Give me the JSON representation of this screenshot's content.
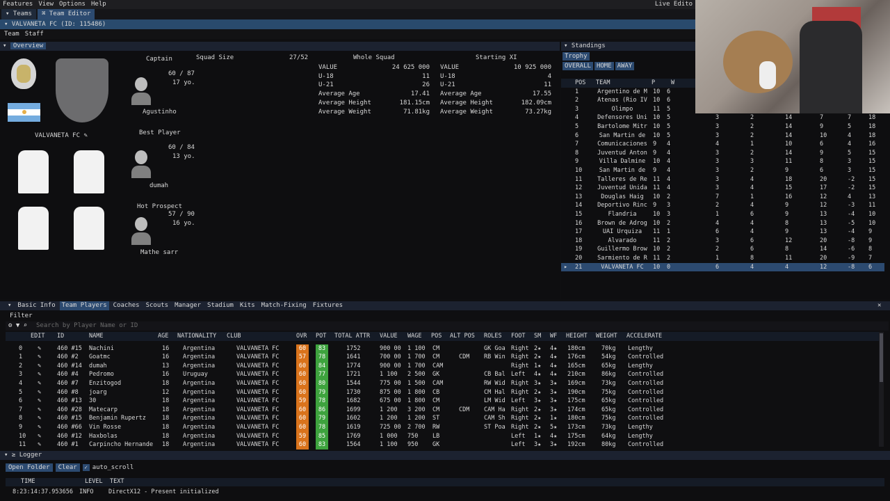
{
  "menubar": {
    "items": [
      "Features",
      "View",
      "Options",
      "Help"
    ],
    "right": "Live Edito"
  },
  "tabs": [
    {
      "label": "▾ Teams"
    },
    {
      "label": "⌘ Team Editor"
    }
  ],
  "title": "VALVANETA FC (ID: 115486)",
  "subtabs": [
    "Team",
    "Staff"
  ],
  "overview": {
    "header": "Overview",
    "club_name": "VALVANETA FC",
    "captain": {
      "label": "Captain",
      "rating": "60 / 87",
      "age": "17 yo.",
      "name": "Agustinho"
    },
    "best": {
      "label": "Best Player",
      "rating": "60 / 84",
      "age": "13 yo.",
      "name": "dumah"
    },
    "prospect": {
      "label": "Hot Prospect",
      "rating": "57 / 90",
      "age": "16 yo.",
      "name": "Mathe sarr"
    },
    "squad_size_label": "Squad Size",
    "squad_size": "27/52",
    "whole_label": "Whole Squad",
    "xi_label": "Starting XI",
    "whole": [
      {
        "k": "VALUE",
        "v": "24 625 000"
      },
      {
        "k": "U-18",
        "v": "11"
      },
      {
        "k": "U-21",
        "v": "26"
      },
      {
        "k": "Average Age",
        "v": "17.41"
      },
      {
        "k": "Average Height",
        "v": "181.15cm"
      },
      {
        "k": "Average Weight",
        "v": "71.81kg"
      }
    ],
    "xi": [
      {
        "k": "VALUE",
        "v": "10 925 000"
      },
      {
        "k": "U-18",
        "v": "4"
      },
      {
        "k": "U-21",
        "v": "11"
      },
      {
        "k": "Average Age",
        "v": "17.55"
      },
      {
        "k": "Average Height",
        "v": "182.09cm"
      },
      {
        "k": "Average Weight",
        "v": "73.27kg"
      }
    ]
  },
  "standings": {
    "header": "Standings",
    "trophy": "Trophy",
    "buttons": [
      "OVERALL",
      "HOME",
      "AWAY"
    ],
    "cols": [
      "POS",
      "TEAM",
      "P",
      "W"
    ],
    "rows": [
      [
        "1",
        "Argentino de M",
        "10",
        "6",
        "",
        "",
        "",
        "",
        "",
        ""
      ],
      [
        "2",
        "Atenas (Rio IV",
        "10",
        "6",
        "",
        "",
        "",
        "",
        "",
        ""
      ],
      [
        "3",
        "Olimpo",
        "11",
        "5",
        "",
        "",
        "",
        "",
        "",
        ""
      ],
      [
        "4",
        "Defensores Uni",
        "10",
        "5",
        "3",
        "2",
        "14",
        "7",
        "7",
        "18"
      ],
      [
        "5",
        "Bartolome Mitr",
        "10",
        "5",
        "3",
        "2",
        "14",
        "9",
        "5",
        "18"
      ],
      [
        "6",
        "San Martin de",
        "10",
        "5",
        "3",
        "2",
        "14",
        "10",
        "4",
        "18"
      ],
      [
        "7",
        "Comunicaciones",
        "9",
        "4",
        "4",
        "1",
        "10",
        "6",
        "4",
        "16"
      ],
      [
        "8",
        "Juventud Anton",
        "9",
        "4",
        "3",
        "2",
        "14",
        "9",
        "5",
        "15"
      ],
      [
        "9",
        "Villa Dalmine",
        "10",
        "4",
        "3",
        "3",
        "11",
        "8",
        "3",
        "15"
      ],
      [
        "10",
        "San Martin de",
        "9",
        "4",
        "3",
        "2",
        "9",
        "6",
        "3",
        "15"
      ],
      [
        "11",
        "Talleres de Re",
        "11",
        "4",
        "3",
        "4",
        "18",
        "20",
        "-2",
        "15"
      ],
      [
        "12",
        "Juventud Unida",
        "11",
        "4",
        "3",
        "4",
        "15",
        "17",
        "-2",
        "15"
      ],
      [
        "13",
        "Douglas Haig",
        "10",
        "2",
        "7",
        "1",
        "16",
        "12",
        "4",
        "13"
      ],
      [
        "14",
        "Deportivo Rinc",
        "9",
        "3",
        "2",
        "4",
        "9",
        "12",
        "-3",
        "11"
      ],
      [
        "15",
        "Flandria",
        "10",
        "3",
        "1",
        "6",
        "9",
        "13",
        "-4",
        "10"
      ],
      [
        "16",
        "Brown de Adrog",
        "10",
        "2",
        "4",
        "4",
        "8",
        "13",
        "-5",
        "10"
      ],
      [
        "17",
        "UAI Urquiza",
        "11",
        "1",
        "6",
        "4",
        "9",
        "13",
        "-4",
        "9"
      ],
      [
        "18",
        "Alvarado",
        "11",
        "2",
        "3",
        "6",
        "12",
        "20",
        "-8",
        "9"
      ],
      [
        "19",
        "Guillermo Brow",
        "10",
        "2",
        "2",
        "6",
        "8",
        "14",
        "-6",
        "8"
      ],
      [
        "20",
        "Sarmiento de R",
        "11",
        "2",
        "1",
        "8",
        "11",
        "20",
        "-9",
        "7"
      ],
      [
        "21",
        "VALVANETA FC",
        "10",
        "0",
        "6",
        "4",
        "4",
        "12",
        "-8",
        "6"
      ]
    ]
  },
  "bottom_tabs": [
    "Basic Info",
    "Team Players",
    "Coaches",
    "Scouts",
    "Manager",
    "Stadium",
    "Kits",
    "Match-Fixing",
    "Fixtures"
  ],
  "filter_label": "Filter",
  "search_placeholder": "Search by Player Name or ID",
  "players": {
    "headers": [
      "EDIT",
      "ID",
      "NAME",
      "AGE",
      "NATIONALITY",
      "CLUB",
      "OVR",
      "POT",
      "TOTAL ATTR",
      "VALUE",
      "WAGE",
      "POS",
      "ALT POS",
      "ROLES",
      "FOOT",
      "SM",
      "WF",
      "HEIGHT",
      "WEIGHT",
      "ACCELERATE"
    ],
    "rows": [
      [
        "0",
        "460 #15",
        "Nachini",
        "16",
        "Argentina",
        "VALVANETA FC",
        "60",
        "83",
        "1752",
        "900 00",
        "1 100",
        "CM",
        "",
        "GK Goa",
        "Right",
        "2★",
        "4★",
        "180cm",
        "70kg",
        "Lengthy"
      ],
      [
        "1",
        "460 #2",
        "Goatmc",
        "16",
        "Argentina",
        "VALVANETA FC",
        "57",
        "78",
        "1641",
        "700 00",
        "1 700",
        "CM",
        "CDM",
        "RB Win",
        "Right",
        "2★",
        "4★",
        "176cm",
        "54kg",
        "Controlled"
      ],
      [
        "2",
        "460 #14",
        "dumah",
        "13",
        "Argentina",
        "VALVANETA FC",
        "60",
        "84",
        "1774",
        "900 00",
        "1 700",
        "CAM",
        "",
        "",
        "Right",
        "1★",
        "4★",
        "165cm",
        "65kg",
        "Lengthy"
      ],
      [
        "3",
        "460 #4",
        "Pedromo",
        "16",
        "Uruguay",
        "VALVANETA FC",
        "60",
        "77",
        "1721",
        "1 100",
        "2 500",
        "GK",
        "",
        "CB Bal",
        "Left",
        "4★",
        "4★",
        "210cm",
        "86kg",
        "Controlled"
      ],
      [
        "4",
        "460 #7",
        "Enzitogod",
        "18",
        "Argentina",
        "VALVANETA FC",
        "60",
        "80",
        "1544",
        "775 00",
        "1 500",
        "CAM",
        "",
        "RW Wid",
        "Right",
        "3★",
        "3★",
        "169cm",
        "73kg",
        "Controlled"
      ],
      [
        "5",
        "460 #8",
        "joarg",
        "12",
        "Argentina",
        "VALVANETA FC",
        "60",
        "79",
        "1730",
        "875 00",
        "1 800",
        "CB",
        "",
        "CM Hal",
        "Right",
        "2★",
        "3★",
        "190cm",
        "75kg",
        "Controlled"
      ],
      [
        "6",
        "460 #13",
        "30",
        "18",
        "Argentina",
        "VALVANETA FC",
        "59",
        "78",
        "1682",
        "675 00",
        "1 800",
        "CM",
        "",
        "LM Wid",
        "Left",
        "3★",
        "3★",
        "175cm",
        "65kg",
        "Controlled"
      ],
      [
        "7",
        "460 #28",
        "Matecarp",
        "18",
        "Argentina",
        "VALVANETA FC",
        "60",
        "86",
        "1699",
        "1 200",
        "3 200",
        "CM",
        "CDM",
        "CAM Ha",
        "Right",
        "2★",
        "3★",
        "174cm",
        "65kg",
        "Controlled"
      ],
      [
        "8",
        "460 #15",
        "Benjamin Rupertz",
        "18",
        "Argentina",
        "VALVANETA FC",
        "60",
        "79",
        "1602",
        "1 200",
        "1 200",
        "ST",
        "",
        "CAM Sh",
        "Right",
        "2★",
        "1★",
        "180cm",
        "75kg",
        "Controlled"
      ],
      [
        "9",
        "460 #66",
        "Vin Rosse",
        "18",
        "Argentina",
        "VALVANETA FC",
        "60",
        "78",
        "1619",
        "725 00",
        "2 700",
        "RW",
        "",
        "ST Poa",
        "Right",
        "2★",
        "5★",
        "173cm",
        "73kg",
        "Lengthy"
      ],
      [
        "10",
        "460 #12",
        "Haxbolas",
        "18",
        "Argentina",
        "VALVANETA FC",
        "59",
        "85",
        "1769",
        "1 000",
        "750",
        "LB",
        "",
        "",
        "Left",
        "1★",
        "4★",
        "175cm",
        "64kg",
        "Lengthy"
      ],
      [
        "11",
        "460 #1",
        "Carpincho Hernande",
        "18",
        "Argentina",
        "VALVANETA FC",
        "60",
        "83",
        "1564",
        "1 100",
        "950",
        "GK",
        "",
        "",
        "Left",
        "3★",
        "3★",
        "192cm",
        "80kg",
        "Controlled"
      ]
    ]
  },
  "logger": {
    "header": "Logger",
    "open_folder": "Open Folder",
    "clear": "Clear",
    "auto_scroll": "auto_scroll",
    "cols": [
      "TIME",
      "LEVEL",
      "TEXT"
    ],
    "entry": {
      "time": "8:23:14:37.953656",
      "level": "INFO",
      "text": "DirectX12 - Present initialized"
    }
  }
}
